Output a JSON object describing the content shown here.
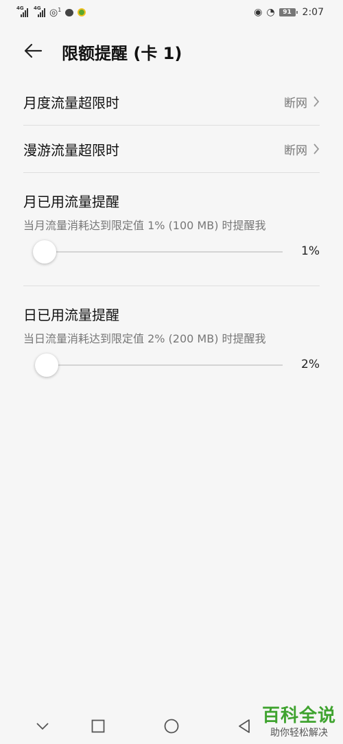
{
  "status_bar": {
    "network_1": "4G",
    "network_2": "4G",
    "hotspot_badge": "1",
    "battery": "91",
    "time": "2:07"
  },
  "header": {
    "title": "限额提醒 (卡 1)"
  },
  "settings": {
    "monthly_limit": {
      "label": "月度流量超限时",
      "value": "断网"
    },
    "roaming_limit": {
      "label": "漫游流量超限时",
      "value": "断网"
    },
    "monthly_reminder": {
      "title": "月已用流量提醒",
      "description": "当月流量消耗达到限定值 1% (100 MB) 时提醒我",
      "value_label": "1%",
      "value_percent": 1
    },
    "daily_reminder": {
      "title": "日已用流量提醒",
      "description": "当日流量消耗达到限定值 2% (200 MB) 时提醒我",
      "value_label": "2%",
      "value_percent": 2
    }
  },
  "navigation": {
    "icons": [
      "chevron-down-icon",
      "square-icon",
      "circle-icon",
      "triangle-back-icon"
    ]
  },
  "watermark": {
    "main": "百科全说",
    "sub": "助你轻松解决"
  },
  "colors": {
    "background": "#f6f6f6",
    "watermark_green": "#3fa32f"
  }
}
